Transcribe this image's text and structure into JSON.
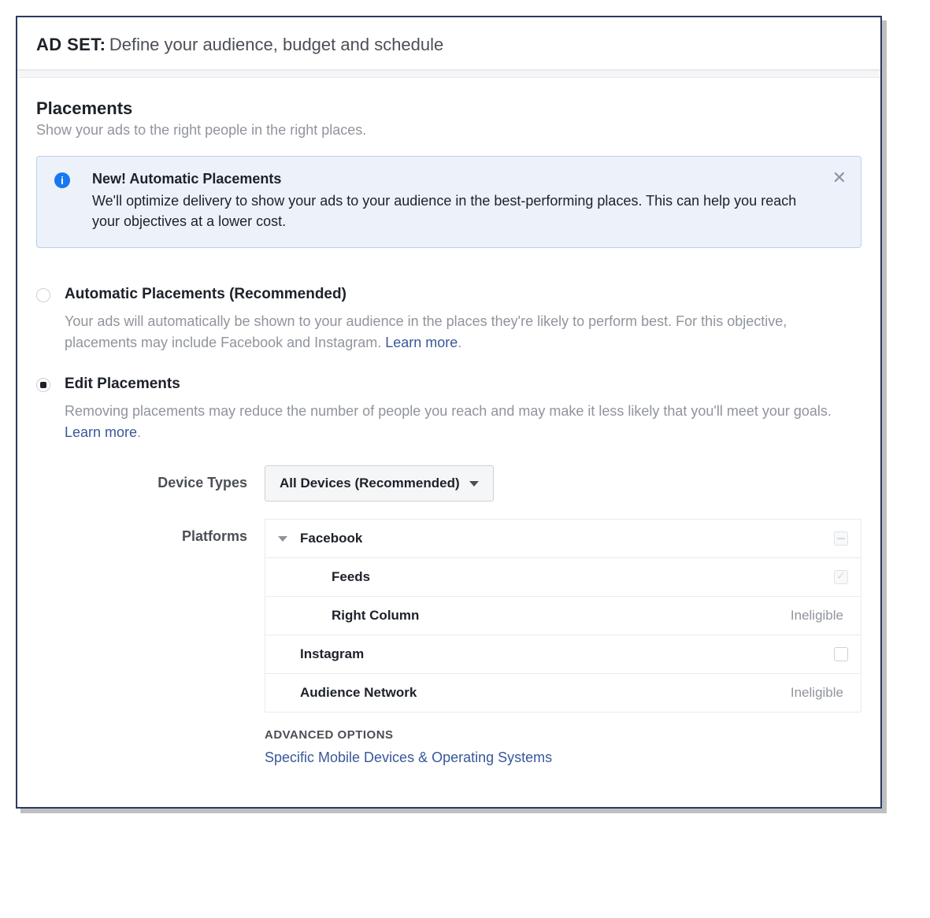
{
  "header": {
    "prefix": "AD SET:",
    "subtitle": "Define your audience, budget and schedule"
  },
  "section": {
    "title": "Placements",
    "subtitle": "Show your ads to the right people in the right places."
  },
  "infobox": {
    "title": "New! Automatic Placements",
    "text": "We'll optimize delivery to show your ads to your audience in the best-performing places. This can help you reach your objectives at a lower cost."
  },
  "options": {
    "auto": {
      "label": "Automatic Placements (Recommended)",
      "desc_before": "Your ads will automatically be shown to your audience in the places they're likely to perform best. For this objective, placements may include Facebook and Instagram. ",
      "learn_more": "Learn more",
      "selected": false
    },
    "edit": {
      "label": "Edit Placements",
      "desc_before": "Removing placements may reduce the number of people you reach and may make it less likely that you'll meet your goals. ",
      "learn_more": "Learn more",
      "selected": true
    }
  },
  "device": {
    "label": "Device Types",
    "value": "All Devices (Recommended)"
  },
  "platforms": {
    "label": "Platforms",
    "rows": [
      {
        "name": "Facebook",
        "level": 0,
        "check": "dash-disabled"
      },
      {
        "name": "Feeds",
        "level": 1,
        "check": "check-disabled"
      },
      {
        "name": "Right Column",
        "level": 1,
        "status": "Ineligible"
      },
      {
        "name": "Instagram",
        "level": 0,
        "check": "empty"
      },
      {
        "name": "Audience Network",
        "level": 0,
        "status": "Ineligible"
      }
    ]
  },
  "advanced": {
    "heading": "ADVANCED OPTIONS",
    "link": "Specific Mobile Devices & Operating Systems"
  }
}
